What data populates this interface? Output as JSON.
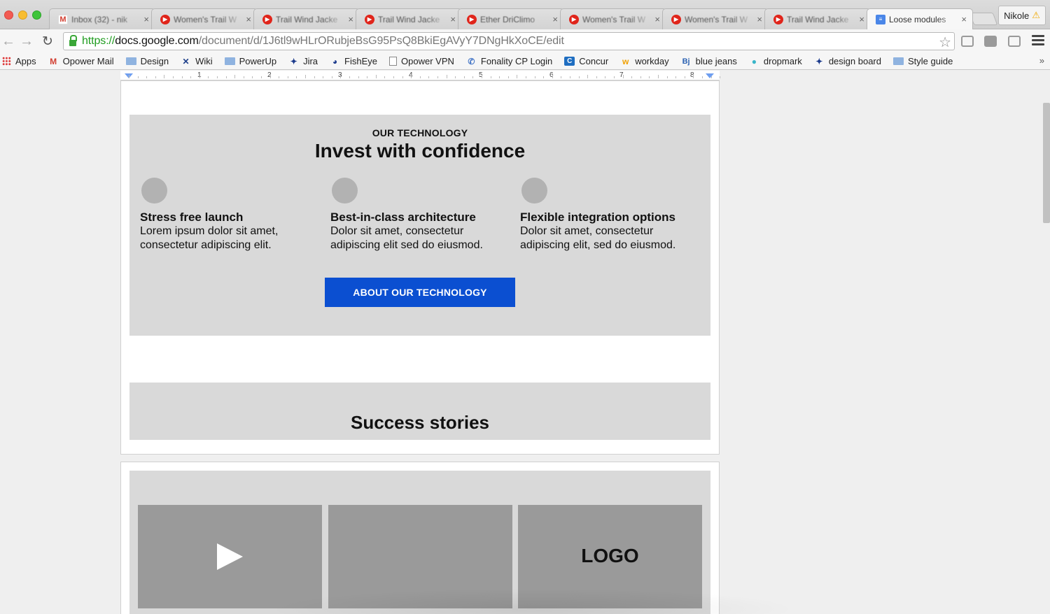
{
  "browser": {
    "tabs": [
      {
        "title": "Inbox (32) - nik",
        "favicon": "gmail-icon"
      },
      {
        "title": "Women's Trail W",
        "favicon": "youtube-icon"
      },
      {
        "title": "Trail Wind Jacke",
        "favicon": "youtube-icon"
      },
      {
        "title": "Trail Wind Jacke",
        "favicon": "youtube-icon"
      },
      {
        "title": "Ether DriClimo",
        "favicon": "youtube-icon"
      },
      {
        "title": "Women's Trail W",
        "favicon": "youtube-icon"
      },
      {
        "title": "Women's Trail W",
        "favicon": "youtube-icon"
      },
      {
        "title": "Trail Wind Jacke",
        "favicon": "youtube-icon"
      },
      {
        "title": "Loose modules",
        "favicon": "docs-icon",
        "active": true
      }
    ],
    "tab_close_glyph": "×",
    "profile_name": "Nikole",
    "url": {
      "scheme": "https://",
      "host": "docs.google.com",
      "path": "/document/d/1J6tl9wHLrORubjeBsG95PsQ8BkiEgAVyY7DNgHkXoCE/edit"
    },
    "bookmarks": [
      {
        "label": "Apps",
        "icon": "apps-grid-icon"
      },
      {
        "label": "Opower Mail",
        "icon": "gmail-icon"
      },
      {
        "label": "Design",
        "icon": "folder-icon"
      },
      {
        "label": "Wiki",
        "icon": "wiki-icon"
      },
      {
        "label": "PowerUp",
        "icon": "folder-icon"
      },
      {
        "label": "Jira",
        "icon": "jira-icon"
      },
      {
        "label": "FishEye",
        "icon": "fisheye-icon"
      },
      {
        "label": "Opower VPN",
        "icon": "page-icon"
      },
      {
        "label": "Fonality CP Login",
        "icon": "phone-icon"
      },
      {
        "label": "Concur",
        "icon": "concur-icon"
      },
      {
        "label": "workday",
        "icon": "workday-icon"
      },
      {
        "label": "blue jeans",
        "icon": "bluejeans-icon"
      },
      {
        "label": "dropmark",
        "icon": "drop-icon"
      },
      {
        "label": "design board",
        "icon": "jira-icon"
      },
      {
        "label": "Style guide",
        "icon": "folder-icon"
      }
    ],
    "bookmarks_more": "»"
  },
  "ruler": {
    "numbers": [
      "1",
      "2",
      "3",
      "4",
      "5",
      "6",
      "7",
      "8"
    ]
  },
  "document": {
    "tech": {
      "eyebrow": "OUR TECHNOLOGY",
      "headline": "Invest with confidence",
      "features": [
        {
          "title": "Stress free launch",
          "body_line1": "Lorem ipsum dolor sit amet,",
          "body_line2": "consectetur adipiscing elit."
        },
        {
          "title": "Best-in-class architecture",
          "body_line1": "Dolor sit amet, consectetur",
          "body_line2": "adipiscing elit sed do eiusmod."
        },
        {
          "title": "Flexible integration options",
          "body_line1": "Dolor sit amet, consectetur",
          "body_line2": "adipiscing elit, sed do eiusmod."
        }
      ],
      "cta_label": "ABOUT OUR TECHNOLOGY",
      "cta_color": "#0b4fd1"
    },
    "stories": {
      "title": "Success stories"
    },
    "gallery": {
      "logo_label": "LOGO"
    }
  },
  "colors": {
    "module_bg": "#d9d9d9",
    "placeholder_gray": "#9a9a9a"
  }
}
